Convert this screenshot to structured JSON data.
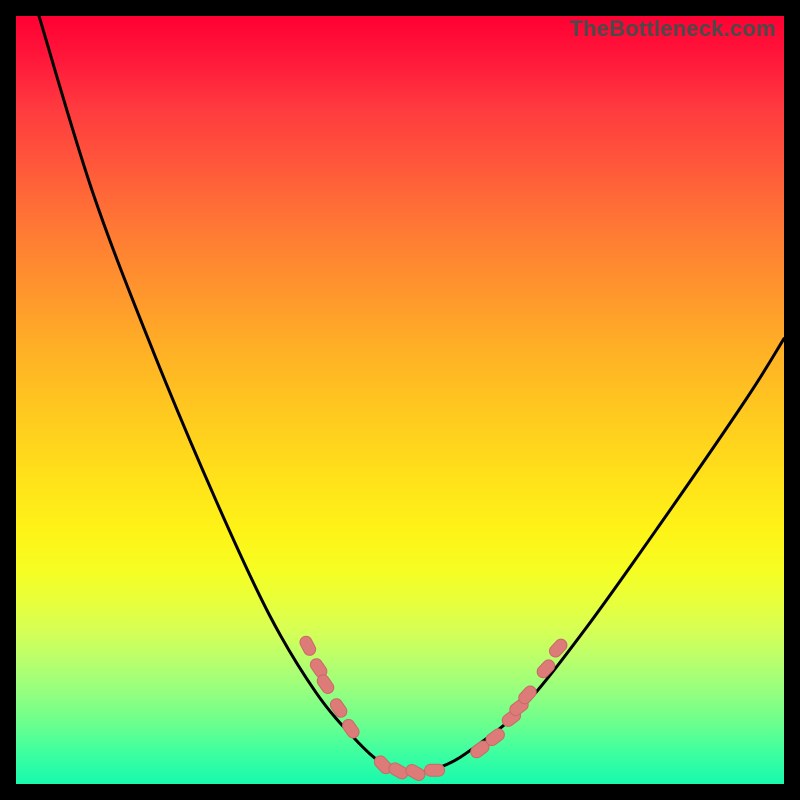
{
  "watermark": {
    "text": "TheBottleneck.com"
  },
  "colors": {
    "frame": "#000000",
    "curve": "#000000",
    "marker_fill": "#dd7b79",
    "marker_stroke": "#c96a68",
    "gradient_stops": [
      "#ff0033",
      "#ffca1f",
      "#18f9ae"
    ]
  },
  "chart_data": {
    "type": "line",
    "title": "",
    "xlabel": "",
    "ylabel": "",
    "xlim": [
      0,
      100
    ],
    "ylim": [
      0,
      100
    ],
    "grid": false,
    "legend": false,
    "note": "Bottleneck-style V-curve. No axes or tick labels are visible. x/y are fractional plot coordinates in [0,1]; y=0 is top.",
    "series": [
      {
        "name": "curve",
        "x": [
          0.03,
          0.1,
          0.18,
          0.26,
          0.33,
          0.39,
          0.44,
          0.48,
          0.52,
          0.56,
          0.6,
          0.66,
          0.74,
          0.84,
          0.95,
          1.0
        ],
        "y": [
          0.0,
          0.23,
          0.44,
          0.63,
          0.78,
          0.88,
          0.94,
          0.975,
          0.985,
          0.975,
          0.95,
          0.9,
          0.8,
          0.66,
          0.5,
          0.42
        ]
      }
    ],
    "markers": {
      "name": "highlighted-points",
      "style": "rounded-pill",
      "color": "#dd7b79",
      "points": [
        {
          "x": 0.38,
          "y": 0.82
        },
        {
          "x": 0.394,
          "y": 0.849
        },
        {
          "x": 0.403,
          "y": 0.87
        },
        {
          "x": 0.42,
          "y": 0.901
        },
        {
          "x": 0.436,
          "y": 0.928
        },
        {
          "x": 0.478,
          "y": 0.975
        },
        {
          "x": 0.498,
          "y": 0.983
        },
        {
          "x": 0.52,
          "y": 0.985
        },
        {
          "x": 0.545,
          "y": 0.982
        },
        {
          "x": 0.604,
          "y": 0.955
        },
        {
          "x": 0.624,
          "y": 0.939
        },
        {
          "x": 0.645,
          "y": 0.914
        },
        {
          "x": 0.655,
          "y": 0.9
        },
        {
          "x": 0.666,
          "y": 0.884
        },
        {
          "x": 0.69,
          "y": 0.85
        },
        {
          "x": 0.706,
          "y": 0.823
        }
      ]
    }
  }
}
